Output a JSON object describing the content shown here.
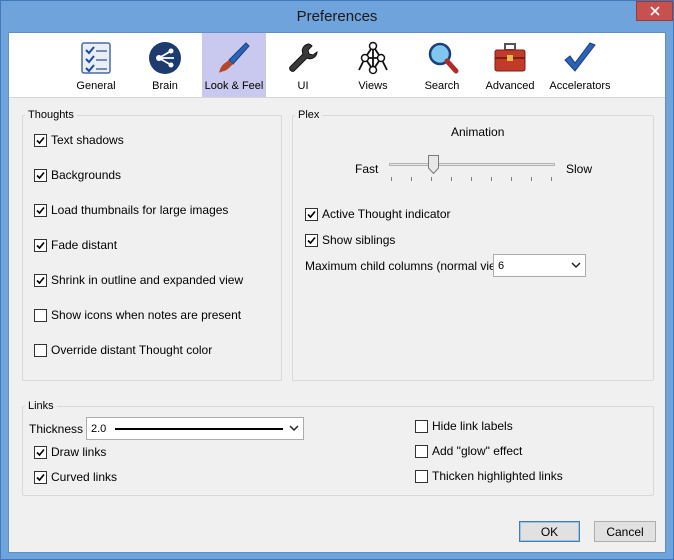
{
  "window": {
    "title": "Preferences"
  },
  "toolbar": {
    "tabs": [
      {
        "label": "General",
        "icon": "checklist-icon"
      },
      {
        "label": "Brain",
        "icon": "brain-logo-icon"
      },
      {
        "label": "Look & Feel",
        "icon": "paintbrush-icon"
      },
      {
        "label": "UI",
        "icon": "wrench-icon"
      },
      {
        "label": "Views",
        "icon": "views-network-icon"
      },
      {
        "label": "Search",
        "icon": "magnifier-icon"
      },
      {
        "label": "Advanced",
        "icon": "toolbox-icon"
      },
      {
        "label": "Accelerators",
        "icon": "checkmark-icon"
      }
    ],
    "selected": "Look & Feel"
  },
  "thoughts": {
    "title": "Thoughts",
    "options": [
      {
        "label": "Text shadows",
        "checked": true
      },
      {
        "label": "Backgrounds",
        "checked": true
      },
      {
        "label": "Load thumbnails for large images",
        "checked": true
      },
      {
        "label": "Fade distant",
        "checked": true
      },
      {
        "label": "Shrink in outline and expanded view",
        "checked": true
      },
      {
        "label": "Show icons when notes are present",
        "checked": false
      },
      {
        "label": "Override distant Thought color",
        "checked": false
      }
    ]
  },
  "plex": {
    "title": "Plex",
    "animation_label": "Animation",
    "fast_label": "Fast",
    "slow_label": "Slow",
    "animation_value_fraction": 0.25,
    "active_thought_indicator": {
      "label": "Active Thought indicator",
      "checked": true
    },
    "show_siblings": {
      "label": "Show siblings",
      "checked": true
    },
    "max_columns_label": "Maximum child columns (normal view)",
    "max_columns_value": "6"
  },
  "links": {
    "title": "Links",
    "thickness_label": "Thickness",
    "thickness_value": "2.0",
    "draw_links": {
      "label": "Draw links",
      "checked": true
    },
    "curved_links": {
      "label": "Curved links",
      "checked": true
    },
    "hide_link_labels": {
      "label": "Hide link labels",
      "checked": false
    },
    "add_glow": {
      "label": "Add \"glow\" effect",
      "checked": false
    },
    "thicken_highlighted": {
      "label": "Thicken highlighted links",
      "checked": false
    }
  },
  "footer": {
    "ok_label": "OK",
    "cancel_label": "Cancel"
  },
  "colors": {
    "titlebar": "#6fa3dc",
    "close": "#c7514f",
    "selected_tab": "#c9c9ef"
  }
}
